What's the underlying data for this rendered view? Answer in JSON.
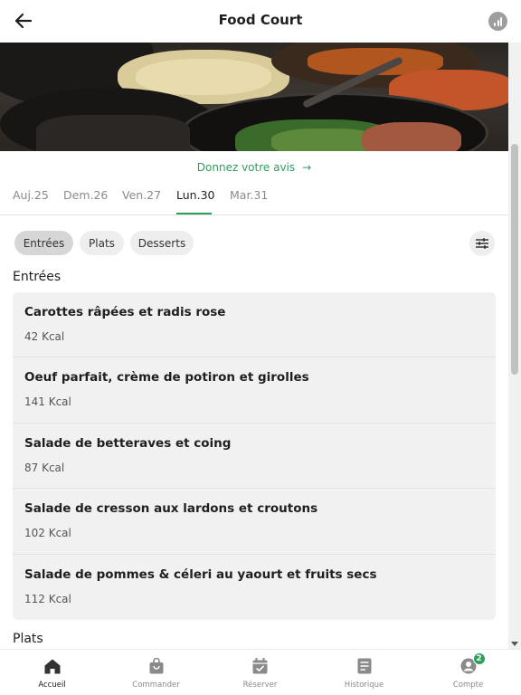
{
  "header": {
    "title": "Food Court",
    "back_icon": "arrow-left-icon",
    "stats_icon": "bar-chart-icon"
  },
  "feedback": {
    "label": "Donnez votre avis",
    "arrow": "→"
  },
  "days": [
    {
      "label": "Auj.25",
      "active": false
    },
    {
      "label": "Dem.26",
      "active": false
    },
    {
      "label": "Ven.27",
      "active": false
    },
    {
      "label": "Lun.30",
      "active": true
    },
    {
      "label": "Mar.31",
      "active": false
    }
  ],
  "categories": [
    {
      "label": "Entrées",
      "active": true
    },
    {
      "label": "Plats",
      "active": false
    },
    {
      "label": "Desserts",
      "active": false
    }
  ],
  "sections": {
    "entrees_title": "Entrées",
    "plats_title": "Plats"
  },
  "entrees": [
    {
      "name": "Carottes râpées et radis rose",
      "kcal": "42 Kcal"
    },
    {
      "name": "Oeuf parfait, crème de potiron et girolles",
      "kcal": "141 Kcal"
    },
    {
      "name": "Salade de betteraves et coing",
      "kcal": "87 Kcal"
    },
    {
      "name": "Salade de cresson aux lardons et croutons",
      "kcal": "102 Kcal"
    },
    {
      "name": "Salade de pommes & céleri au yaourt et fruits secs",
      "kcal": "112 Kcal"
    }
  ],
  "bottom_nav": [
    {
      "label": "Accueil",
      "icon": "home-icon",
      "active": true
    },
    {
      "label": "Commander",
      "icon": "shopping-bag-icon",
      "active": false
    },
    {
      "label": "Réserver",
      "icon": "calendar-check-icon",
      "active": false
    },
    {
      "label": "Historique",
      "icon": "document-icon",
      "active": false
    },
    {
      "label": "Compte",
      "icon": "account-icon",
      "active": false,
      "badge": "2"
    }
  ],
  "colors": {
    "accent": "#2e9e5b",
    "card_bg": "#f1f1f1",
    "chip_active": "#d6d6d6"
  }
}
